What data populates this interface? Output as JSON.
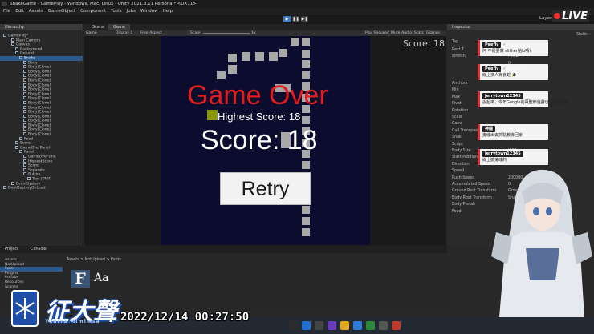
{
  "window": {
    "title": "SnakeGame - GamePlay - Windows, Mac, Linux - Unity 2021.3.11 Personal* <DX11>"
  },
  "menu": [
    "File",
    "Edit",
    "Assets",
    "GameObject",
    "Component",
    "Tools",
    "Jobs",
    "Window",
    "Help"
  ],
  "toolbar": {
    "play": "▶",
    "pause": "❚❚",
    "step": "▶❚",
    "layers": "Layers",
    "live": "LIVE"
  },
  "hierarchy": {
    "tab": "Hierarchy",
    "items": [
      {
        "label": "GamePlay*",
        "indent": 0,
        "selected": false
      },
      {
        "label": "Main Camera",
        "indent": 2,
        "selected": false
      },
      {
        "label": "Canvas",
        "indent": 2,
        "selected": false
      },
      {
        "label": "Background",
        "indent": 3,
        "selected": false
      },
      {
        "label": "Ground",
        "indent": 3,
        "selected": false
      },
      {
        "label": "Snake",
        "indent": 4,
        "selected": true
      },
      {
        "label": "Body",
        "indent": 5,
        "selected": false
      },
      {
        "label": "Body(Clone)",
        "indent": 5,
        "selected": false
      },
      {
        "label": "Body(Clone)",
        "indent": 5,
        "selected": false
      },
      {
        "label": "Body(Clone)",
        "indent": 5,
        "selected": false
      },
      {
        "label": "Body(Clone)",
        "indent": 5,
        "selected": false
      },
      {
        "label": "Body(Clone)",
        "indent": 5,
        "selected": false
      },
      {
        "label": "Body(Clone)",
        "indent": 5,
        "selected": false
      },
      {
        "label": "Body(Clone)",
        "indent": 5,
        "selected": false
      },
      {
        "label": "Body(Clone)",
        "indent": 5,
        "selected": false
      },
      {
        "label": "Body(Clone)",
        "indent": 5,
        "selected": false
      },
      {
        "label": "Body(Clone)",
        "indent": 5,
        "selected": false
      },
      {
        "label": "Body(Clone)",
        "indent": 5,
        "selected": false
      },
      {
        "label": "Body(Clone)",
        "indent": 5,
        "selected": false
      },
      {
        "label": "Body(Clone)",
        "indent": 5,
        "selected": false
      },
      {
        "label": "Body(Clone)",
        "indent": 5,
        "selected": false
      },
      {
        "label": "Body(Clone)",
        "indent": 5,
        "selected": false
      },
      {
        "label": "Body(Clone)",
        "indent": 5,
        "selected": false
      },
      {
        "label": "Food",
        "indent": 4,
        "selected": false
      },
      {
        "label": "Score",
        "indent": 3,
        "selected": false
      },
      {
        "label": "GameOverPanel",
        "indent": 3,
        "selected": false
      },
      {
        "label": "Panel",
        "indent": 4,
        "selected": false
      },
      {
        "label": "GameOverTitle",
        "indent": 5,
        "selected": false
      },
      {
        "label": "HighestScore",
        "indent": 5,
        "selected": false
      },
      {
        "label": "Score",
        "indent": 5,
        "selected": false
      },
      {
        "label": "Separate",
        "indent": 5,
        "selected": false
      },
      {
        "label": "Button",
        "indent": 5,
        "selected": false
      },
      {
        "label": "Text (TMP)",
        "indent": 6,
        "selected": false
      },
      {
        "label": "EventSystem",
        "indent": 2,
        "selected": false
      },
      {
        "label": "DontDestroyOnLoad",
        "indent": 0,
        "selected": false
      }
    ]
  },
  "game_view": {
    "tabs": [
      "Scene",
      "Game"
    ],
    "display": "Game",
    "display_num": "Display 1",
    "aspect": "Free Aspect",
    "scale_label": "Scale",
    "scale_val": "1x",
    "play_focused": "Play Focused",
    "mute": "Mute Audio",
    "stats": "Stats",
    "gizmos": "Gizmos",
    "score_corner": "Score: 18",
    "game_over": "Game Over",
    "highest_score": "Highest Score: 18",
    "score": "Score: 18",
    "retry": "Retry"
  },
  "inspector": {
    "tab": "Inspector",
    "static": "Static",
    "tag": "Tag",
    "rows": [
      {
        "label": "Rect T",
        "value": ""
      },
      {
        "label": "stretch",
        "value": "Pos Z"
      },
      {
        "label": "",
        "value": "0"
      },
      {
        "label": "",
        "value": "Bottom"
      },
      {
        "label": "",
        "value": "0"
      },
      {
        "label": "Anchors",
        "value": ""
      },
      {
        "label": "Min",
        "value": ""
      },
      {
        "label": "Max",
        "value": ""
      },
      {
        "label": "Pivot",
        "value": ""
      },
      {
        "label": "Rotation",
        "value": ""
      },
      {
        "label": "Scale",
        "value": ""
      },
      {
        "label": "Canv",
        "value": ""
      },
      {
        "label": "Cull Transparen",
        "value": ""
      },
      {
        "label": "Snak",
        "value": ""
      },
      {
        "label": "Script",
        "value": ""
      },
      {
        "label": "Body Size",
        "value": "X 90"
      },
      {
        "label": "Start Position",
        "value": "Y 500"
      },
      {
        "label": "Direction",
        "value": ""
      },
      {
        "label": "Speed",
        "value": ""
      },
      {
        "label": "Rush Speed",
        "value": "200000"
      },
      {
        "label": "Accumulated Speed",
        "value": "0"
      },
      {
        "label": "Ground Rect Transform",
        "value": "Ground (Rect Transform)"
      },
      {
        "label": "Body Root Transform",
        "value": "Snake (Rect Transform)"
      },
      {
        "label": "Body Prefab",
        "value": ""
      },
      {
        "label": "Food",
        "value": ""
      }
    ]
  },
  "chat": [
    {
      "name": "Peefly",
      "badge": "✓",
      "msg": "阿 不是要做 slither點io嗎?"
    },
    {
      "name": "Peefly",
      "badge": "✓",
      "msg": "線上多人貪食蛇 🎓"
    },
    {
      "name": "jerrytown12345",
      "badge": "",
      "msg": "說起來，今年Google的萬聖節遊戲也是像貪吃蛇"
    },
    {
      "name": "神龍",
      "badge": "",
      "msg": "鬼魂出去抓點教導回家"
    },
    {
      "name": "jerrytown12345",
      "badge": "",
      "msg": "線上搶鬼魂的"
    }
  ],
  "project": {
    "tabs": [
      "Project",
      "Console"
    ],
    "tree": [
      "Assets",
      "NotUpload",
      "Fonts",
      "Plugins",
      "Prefabs",
      "Resources",
      "Scenes"
    ],
    "breadcrumb": "Assets > NotUpload > Fonts",
    "font_icon": "F",
    "font_aa": "Aa"
  },
  "branding": {
    "name": "征大聲",
    "sub": "YuniYa Mimimsa"
  },
  "clock": "2022/12/14 00:27:50",
  "colors": {
    "game_over_red": "#e21b1b",
    "viewport_bg": "#0c0c2e",
    "snake_gray": "#a8a8a8",
    "food_green": "#8a9a06",
    "play_blue": "#3b78c7"
  }
}
